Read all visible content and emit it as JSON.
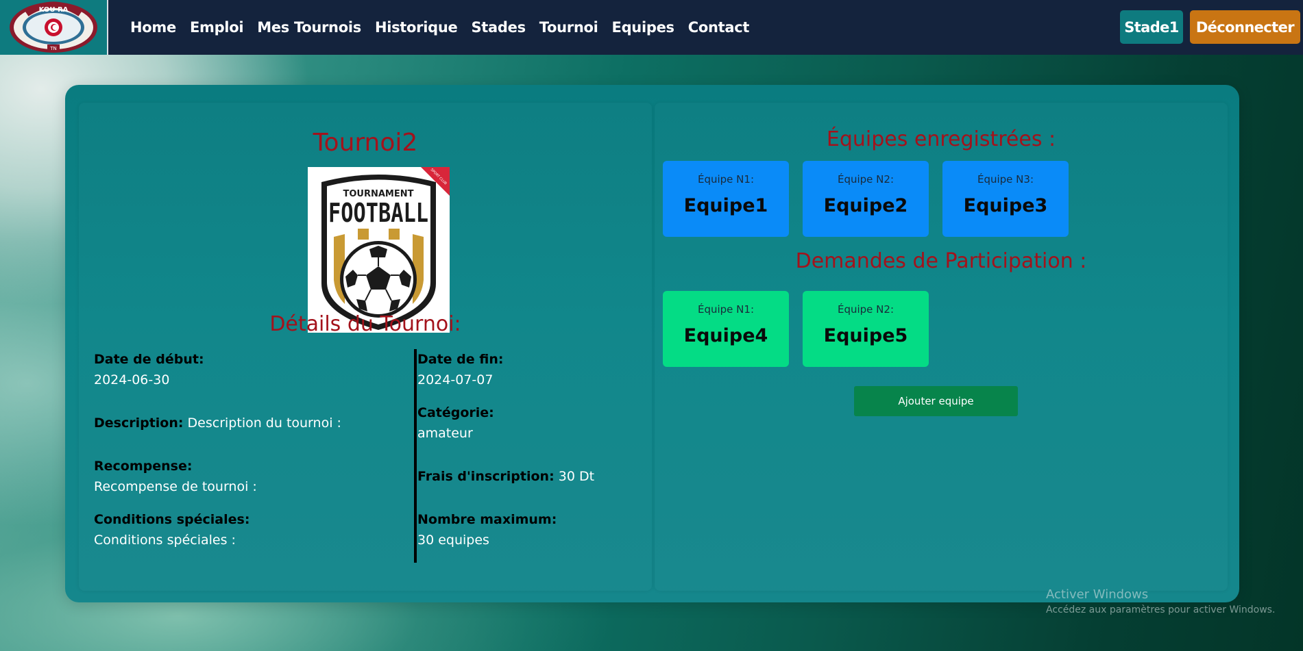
{
  "brand": {
    "logo_text_top": "KOU RA",
    "logo_text_bottom": "TN"
  },
  "nav": {
    "links": [
      "Home",
      "Emploi",
      "Mes Tournois",
      "Historique",
      "Stades",
      "Tournoi",
      "Equipes",
      "Contact"
    ],
    "stade_button": "Stade1",
    "logout_button": "Déconnecter"
  },
  "tournament": {
    "name": "Tournoi2",
    "poster": {
      "line1": "TOURNAMENT",
      "line2": "FOOTBALL",
      "ribbon": "SPORT CLUB"
    },
    "details_title": "Détails du Tournoi:",
    "fields": {
      "start_date": {
        "label": "Date de début:",
        "value": "2024-06-30"
      },
      "end_date": {
        "label": "Date de fin:",
        "value": "2024-07-07"
      },
      "description": {
        "label": "Description:",
        "value": "Description du tournoi :"
      },
      "category": {
        "label": "Catégorie:",
        "value": "amateur"
      },
      "reward": {
        "label": "Recompense:",
        "value": "Recompense de tournoi :"
      },
      "fee": {
        "label": "Frais d'inscription:",
        "value": "30 Dt"
      },
      "special_conditions": {
        "label": "Conditions spéciales:",
        "value": "Conditions spéciales :"
      },
      "max_number": {
        "label": "Nombre maximum:",
        "value": "30 equipes"
      }
    }
  },
  "registered": {
    "title": "Équipes enregistrées :",
    "teams": [
      {
        "label": "Équipe N1:",
        "name": "Equipe1"
      },
      {
        "label": "Équipe N2:",
        "name": "Equipe2"
      },
      {
        "label": "Équipe N3:",
        "name": "Equipe3"
      }
    ]
  },
  "requests": {
    "title": "Demandes de Participation :",
    "teams": [
      {
        "label": "Équipe N1:",
        "name": "Equipe4"
      },
      {
        "label": "Équipe N2:",
        "name": "Equipe5"
      }
    ]
  },
  "add_team_button": "Ajouter equipe",
  "watermark": {
    "line1": "Activer Windows",
    "line2": "Accédez aux paramètres pour activer Windows."
  },
  "colors": {
    "navbar": "#14233d",
    "accent_teal": "#0e7b7f",
    "logout_orange": "#c97513",
    "title_red": "#a3121b",
    "team_blue": "#0a8bf8",
    "team_green": "#04dc85",
    "add_button_green": "#07844b"
  }
}
